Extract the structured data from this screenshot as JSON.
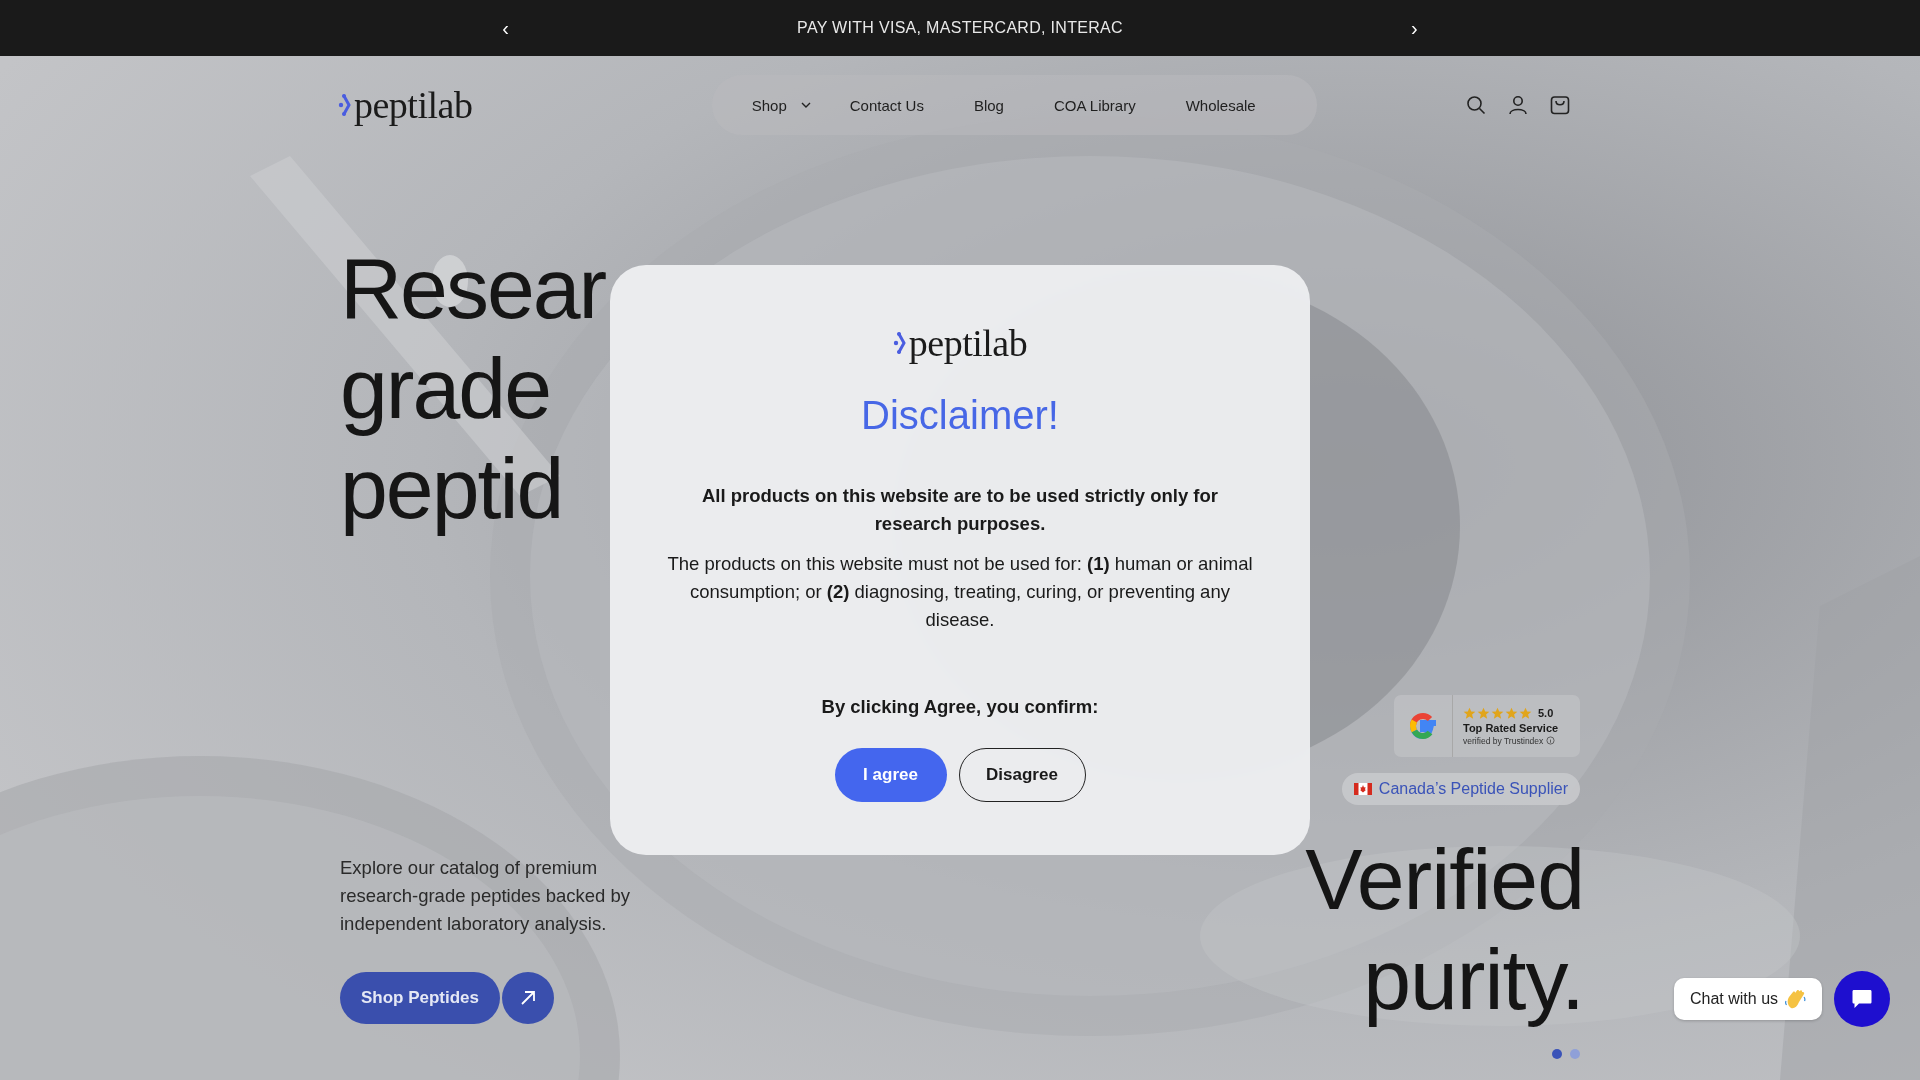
{
  "announcement": {
    "prev": "‹",
    "text": "PAY WITH VISA, MASTERCARD, INTERAC",
    "next": "›"
  },
  "header": {
    "logo": "peptilab",
    "nav": [
      {
        "label": "Shop",
        "has_dropdown": true
      },
      {
        "label": "Contact Us",
        "has_dropdown": false
      },
      {
        "label": "Blog",
        "has_dropdown": false
      },
      {
        "label": "COA Library",
        "has_dropdown": false
      },
      {
        "label": "Wholesale",
        "has_dropdown": false
      }
    ]
  },
  "hero": {
    "heading_lines": [
      "Resear",
      "grade",
      "peptid"
    ],
    "description": "Explore our catalog of premium research-grade peptides backed by independent laboratory analysis.",
    "cta": "Shop Peptides",
    "rating": {
      "stars": 5,
      "score": "5.0",
      "title": "Top Rated Service",
      "verified": "verified by Trustindex"
    },
    "badge": "Canada’s Peptide Supplier",
    "tagline_lines": [
      "Verified",
      "purity."
    ],
    "slides": [
      {
        "selected": true
      },
      {
        "selected": false
      }
    ]
  },
  "modal": {
    "logo": "peptilab",
    "title": "Disclaimer!",
    "lead": "All products on this website are to be used strictly only for research purposes.",
    "body": "The products on this website must not be used for: **(1)** human or animal consumption; or **(2)** diagnosing, treating, curing, or preventing any disease.",
    "confirm": "By clicking Agree, you confirm:",
    "buttons": [
      {
        "label": "I agree",
        "kind": "primary"
      },
      {
        "label": "Disagree",
        "kind": "secondary"
      }
    ]
  },
  "chat": {
    "label": "Chat with us"
  }
}
